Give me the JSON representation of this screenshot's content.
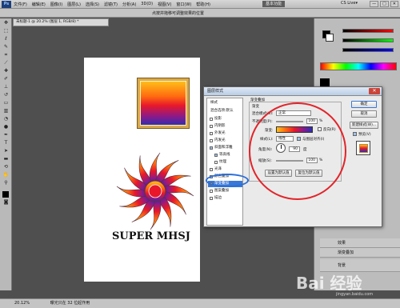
{
  "menubar": {
    "app_logo": "Ps",
    "items": [
      "文件(F)",
      "编辑(E)",
      "图像(I)",
      "图层(L)",
      "选择(S)",
      "滤镜(T)",
      "分析(A)",
      "3D(D)",
      "视图(V)",
      "窗口(W)",
      "帮助(H)"
    ],
    "workspace": "基本功能",
    "cs_live": "CS Live▾",
    "window_buttons": [
      "—",
      "□",
      "✕"
    ]
  },
  "optbar": {
    "title": "点按并拖移可调整效果的位置"
  },
  "document": {
    "tab": "未标题-1 @ 20.2% (图层 1, RGB/8) *",
    "zoom": "20.12%",
    "status": "曝光只在 32 位起作用"
  },
  "artwork": {
    "logo_text": "SUPER MHSJ"
  },
  "dialog": {
    "title": "图层样式",
    "style_list": {
      "header": "样式",
      "items": [
        {
          "label": "混合选项:默认",
          "checked": false,
          "has_checkbox": false
        },
        {
          "label": "投影",
          "checked": false,
          "has_checkbox": true
        },
        {
          "label": "内阴影",
          "checked": false,
          "has_checkbox": true
        },
        {
          "label": "外发光",
          "checked": false,
          "has_checkbox": true
        },
        {
          "label": "内发光",
          "checked": false,
          "has_checkbox": true
        },
        {
          "label": "斜面和浮雕",
          "checked": true,
          "has_checkbox": true
        },
        {
          "label": "等高线",
          "checked": true,
          "has_checkbox": true
        },
        {
          "label": "纹理",
          "checked": false,
          "has_checkbox": true
        },
        {
          "label": "光泽",
          "checked": false,
          "has_checkbox": true
        },
        {
          "label": "颜色叠加",
          "checked": false,
          "has_checkbox": true
        },
        {
          "label": "渐变叠加",
          "checked": true,
          "has_checkbox": true,
          "selected": true
        },
        {
          "label": "图案叠加",
          "checked": false,
          "has_checkbox": true
        },
        {
          "label": "描边",
          "checked": false,
          "has_checkbox": true
        }
      ]
    },
    "gradient_overlay": {
      "group_title": "渐变叠加",
      "sub_title": "渐变",
      "blend_mode_label": "混合模式(O):",
      "blend_mode_value": "正常",
      "opacity_label": "不透明度(P):",
      "opacity_value": "100",
      "percent": "%",
      "gradient_label": "渐变:",
      "reverse_label": "反向(R)",
      "style_label": "样式(L):",
      "style_value": "线性",
      "align_label": "与图层对齐(I)",
      "angle_label": "角度(N):",
      "angle_value": "90",
      "angle_unit": "度",
      "scale_label": "缩放(S):",
      "scale_value": "100",
      "btn_default": "设置为默认值",
      "btn_reset": "复位为默认值"
    },
    "right": {
      "ok": "确定",
      "cancel": "取消",
      "new_style": "新建样式(W)...",
      "preview": "预览(V)"
    }
  },
  "panels": {
    "layer_names": [
      "效果",
      "渐变叠加",
      "背景"
    ]
  },
  "watermark": {
    "text": "Bai 经验",
    "sub": "jingyan.baidu.com"
  },
  "colors": {
    "gradient_stops": [
      "#ffc21a",
      "#ff6a10",
      "#e8182a",
      "#8a1a8a",
      "#2b2fb0"
    ],
    "annotation_red": "#e2242a",
    "annotation_blue": "#2a6fd8",
    "selection_blue": "#3a78d8"
  }
}
